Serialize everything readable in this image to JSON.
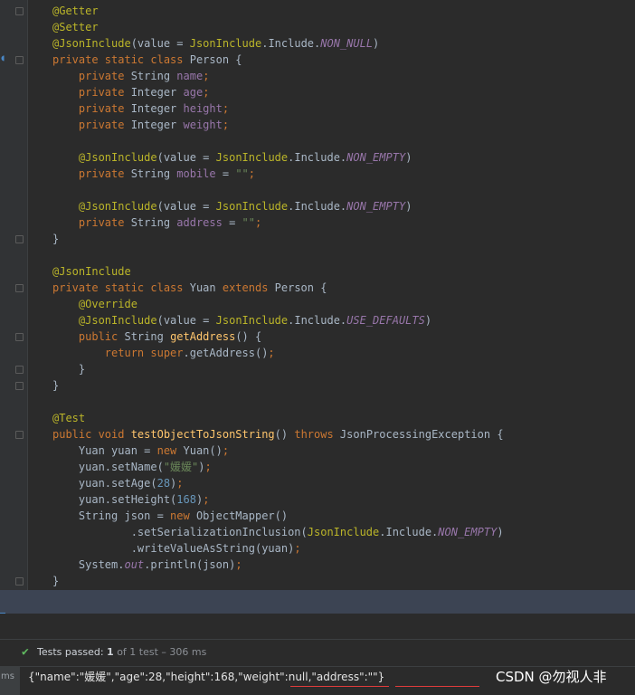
{
  "code": {
    "lines": [
      [
        [
          "ann",
          "@Getter"
        ]
      ],
      [
        [
          "ann",
          "@Setter"
        ]
      ],
      [
        [
          "ann",
          "@JsonInclude"
        ],
        [
          "",
          "(value = "
        ],
        [
          "cls",
          "JsonInclude"
        ],
        [
          "",
          ".Include."
        ],
        [
          "cst",
          "NON_NULL"
        ],
        [
          "",
          ")"
        ]
      ],
      [
        [
          "kw",
          "private static class "
        ],
        [
          "",
          "Person {"
        ]
      ],
      [
        [
          "",
          "    "
        ],
        [
          "kw",
          "private "
        ],
        [
          "",
          "String "
        ],
        [
          "fld",
          "name"
        ],
        [
          "kw",
          ";"
        ]
      ],
      [
        [
          "",
          "    "
        ],
        [
          "kw",
          "private "
        ],
        [
          "",
          "Integer "
        ],
        [
          "fld",
          "age"
        ],
        [
          "kw",
          ";"
        ]
      ],
      [
        [
          "",
          "    "
        ],
        [
          "kw",
          "private "
        ],
        [
          "",
          "Integer "
        ],
        [
          "fld",
          "height"
        ],
        [
          "kw",
          ";"
        ]
      ],
      [
        [
          "",
          "    "
        ],
        [
          "kw",
          "private "
        ],
        [
          "",
          "Integer "
        ],
        [
          "fld",
          "weight"
        ],
        [
          "kw",
          ";"
        ]
      ],
      [],
      [
        [
          "",
          "    "
        ],
        [
          "ann",
          "@JsonInclude"
        ],
        [
          "",
          "(value = "
        ],
        [
          "cls",
          "JsonInclude"
        ],
        [
          "",
          ".Include."
        ],
        [
          "cst",
          "NON_EMPTY"
        ],
        [
          "",
          ")"
        ]
      ],
      [
        [
          "",
          "    "
        ],
        [
          "kw",
          "private "
        ],
        [
          "",
          "String "
        ],
        [
          "fld",
          "mobile"
        ],
        [
          "",
          " = "
        ],
        [
          "str",
          "\"\""
        ],
        [
          "kw",
          ";"
        ]
      ],
      [],
      [
        [
          "",
          "    "
        ],
        [
          "ann",
          "@JsonInclude"
        ],
        [
          "",
          "(value = "
        ],
        [
          "cls",
          "JsonInclude"
        ],
        [
          "",
          ".Include."
        ],
        [
          "cst",
          "NON_EMPTY"
        ],
        [
          "",
          ")"
        ]
      ],
      [
        [
          "",
          "    "
        ],
        [
          "kw",
          "private "
        ],
        [
          "",
          "String "
        ],
        [
          "fld",
          "address"
        ],
        [
          "",
          " = "
        ],
        [
          "str",
          "\"\""
        ],
        [
          "kw",
          ";"
        ]
      ],
      [
        [
          "",
          "}"
        ]
      ],
      [],
      [
        [
          "ann",
          "@JsonInclude"
        ]
      ],
      [
        [
          "kw",
          "private static class "
        ],
        [
          "",
          "Yuan "
        ],
        [
          "kw",
          "extends "
        ],
        [
          "",
          "Person {"
        ]
      ],
      [
        [
          "",
          "    "
        ],
        [
          "ann",
          "@Override"
        ]
      ],
      [
        [
          "",
          "    "
        ],
        [
          "ann",
          "@JsonInclude"
        ],
        [
          "",
          "(value = "
        ],
        [
          "cls",
          "JsonInclude"
        ],
        [
          "",
          ".Include."
        ],
        [
          "cst",
          "USE_DEFAULTS"
        ],
        [
          "",
          ")"
        ]
      ],
      [
        [
          "",
          "    "
        ],
        [
          "kw",
          "public "
        ],
        [
          "",
          "String "
        ],
        [
          "mth",
          "getAddress"
        ],
        [
          "",
          "() {"
        ]
      ],
      [
        [
          "",
          "        "
        ],
        [
          "kw",
          "return super"
        ],
        [
          "",
          ".getAddress()"
        ],
        [
          "kw",
          ";"
        ]
      ],
      [
        [
          "",
          "    }"
        ]
      ],
      [
        [
          "",
          "}"
        ]
      ],
      [],
      [
        [
          "ann",
          "@Test"
        ]
      ],
      [
        [
          "kw",
          "public void "
        ],
        [
          "mth",
          "testObjectToJsonString"
        ],
        [
          "",
          "() "
        ],
        [
          "kw",
          "throws "
        ],
        [
          "",
          "JsonProcessingException {"
        ]
      ],
      [
        [
          "",
          "    Yuan yuan = "
        ],
        [
          "kw",
          "new "
        ],
        [
          "",
          "Yuan()"
        ],
        [
          "kw",
          ";"
        ]
      ],
      [
        [
          "",
          "    yuan.setName("
        ],
        [
          "str",
          "\"媛媛\""
        ],
        [
          "",
          ")"
        ],
        [
          "kw",
          ";"
        ]
      ],
      [
        [
          "",
          "    yuan.setAge("
        ],
        [
          "num",
          "28"
        ],
        [
          "",
          ")"
        ],
        [
          "kw",
          ";"
        ]
      ],
      [
        [
          "",
          "    yuan.setHeight("
        ],
        [
          "num",
          "168"
        ],
        [
          "",
          ")"
        ],
        [
          "kw",
          ";"
        ]
      ],
      [
        [
          "",
          "    String json = "
        ],
        [
          "kw",
          "new "
        ],
        [
          "",
          "ObjectMapper()"
        ]
      ],
      [
        [
          "",
          "            .setSerializationInclusion("
        ],
        [
          "cls",
          "JsonInclude"
        ],
        [
          "",
          ".Include."
        ],
        [
          "cst",
          "NON_EMPTY"
        ],
        [
          "",
          ")"
        ]
      ],
      [
        [
          "",
          "            .writeValueAsString(yuan)"
        ],
        [
          "kw",
          ";"
        ]
      ],
      [
        [
          "",
          "    System."
        ],
        [
          "cst",
          "out"
        ],
        [
          "",
          ".println(json)"
        ],
        [
          "kw",
          ";"
        ]
      ],
      [
        [
          "",
          "}"
        ]
      ]
    ]
  },
  "test_status": {
    "prefix": "Tests passed:",
    "passed": "1",
    "of_text": "of 1 test – 306 ms"
  },
  "console": {
    "tag": "ms",
    "output": "{\"name\":\"媛媛\",\"age\":28,\"height\":168,\"weight\":null,\"address\":\"\"}"
  },
  "watermark": "CSDN @勿视人非",
  "colors": {
    "editor_bg": "#2b2b2b",
    "keyword": "#cc7832",
    "annotation": "#bbb529",
    "string": "#6a8759",
    "number": "#6897bb",
    "field": "#9876aa",
    "method": "#ffc66d",
    "pass_check": "#5fb85f",
    "underline": "#e03b3b"
  },
  "icons": {
    "pass": "check-icon",
    "fold": "fold-marker-icon"
  }
}
